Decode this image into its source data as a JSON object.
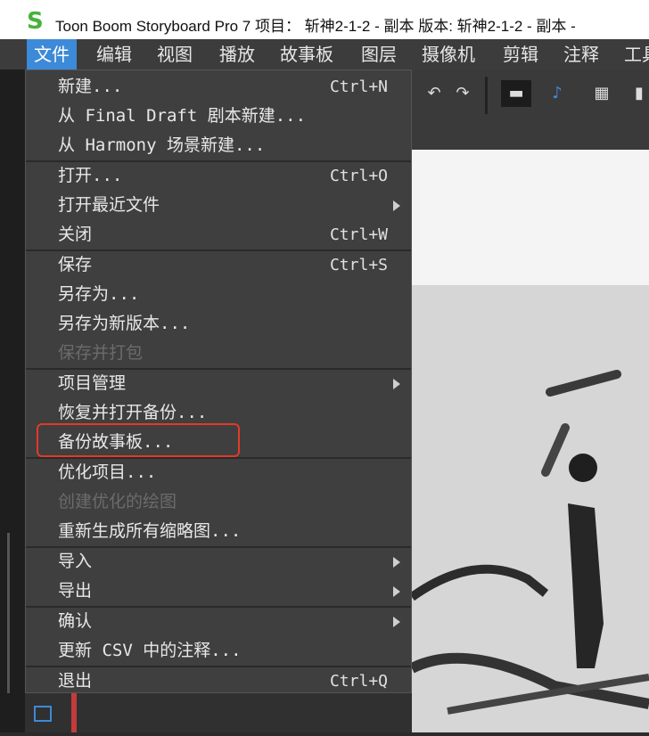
{
  "window": {
    "title": "Toon Boom Storyboard Pro 7 项目： 斩神2-1-2 - 副本 版本: 斩神2-1-2 - 副本 -",
    "logo": "S"
  },
  "menubar": {
    "items": [
      "文件",
      "编辑",
      "视图",
      "播放",
      "故事板",
      "图层",
      "摄像机",
      "剪辑",
      "注释",
      "工具"
    ]
  },
  "file_menu": {
    "groups": [
      [
        {
          "label": "新建...",
          "shortcut": "Ctrl+N"
        },
        {
          "label": "从 Final Draft 剧本新建..."
        },
        {
          "label": "从 Harmony 场景新建..."
        }
      ],
      [
        {
          "label": "打开...",
          "shortcut": "Ctrl+O"
        },
        {
          "label": "打开最近文件",
          "submenu": true
        },
        {
          "label": "关闭",
          "shortcut": "Ctrl+W"
        }
      ],
      [
        {
          "label": "保存",
          "shortcut": "Ctrl+S"
        },
        {
          "label": "另存为..."
        },
        {
          "label": "另存为新版本..."
        },
        {
          "label": "保存并打包",
          "disabled": true
        }
      ],
      [
        {
          "label": "项目管理",
          "submenu": true
        },
        {
          "label": "恢复并打开备份..."
        },
        {
          "label": "备份故事板...",
          "highlighted": true
        }
      ],
      [
        {
          "label": "优化项目..."
        },
        {
          "label": "创建优化的绘图",
          "disabled": true
        },
        {
          "label": "重新生成所有缩略图..."
        }
      ],
      [
        {
          "label": "导入",
          "submenu": true
        },
        {
          "label": "导出",
          "submenu": true
        }
      ],
      [
        {
          "label": "确认",
          "submenu": true
        },
        {
          "label": "更新 CSV 中的注释..."
        }
      ],
      [
        {
          "label": "退出",
          "shortcut": "Ctrl+Q"
        }
      ]
    ]
  },
  "toolbar": {
    "icons": [
      "undo-icon",
      "redo-icon",
      "strip-view-icon",
      "music-staff-icon",
      "grid-icon",
      "panel-icon"
    ]
  },
  "colors": {
    "accent": "#3d8ad8",
    "highlight_box": "#e23a2a",
    "menu_bg": "#3f3f3f"
  }
}
